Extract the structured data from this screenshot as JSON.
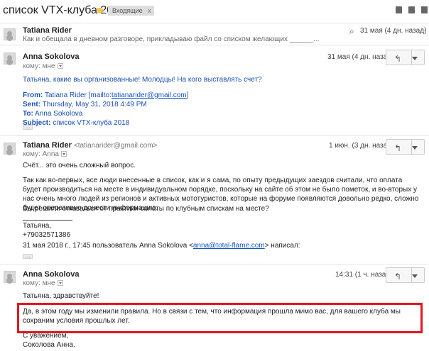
{
  "thread": {
    "subject": "список VTX-клуба 2018",
    "inbox_label": "Входящие",
    "inbox_close": "x"
  },
  "messages": [
    {
      "sender": "Tatiana Rider",
      "snippet": "Как и обещала в дневном разговоре, прикладываю файл со списком желающих ______...",
      "date": "31 мая (4 дн. назад)"
    },
    {
      "sender": "Anna Sokolova",
      "to": "кому: мне",
      "date": "31 мая (4 дн. назад)",
      "text": "Татьяна, какие вы организованные! Молодцы! На кого выставлять счет?",
      "quote": {
        "from_label": "From:",
        "from_value": "Tatiana Rider [mailto:",
        "from_link": "tatianarider@gmail.com",
        "from_end": "]",
        "sent_label": "Sent:",
        "sent_value": "Thursday, May 31, 2018 4:49 PM",
        "to_label": "To:",
        "to_value": "Anna Sokolova",
        "subject_label": "Subject:",
        "subject_value": "список VTX-клуба 2018"
      }
    },
    {
      "sender": "Tatiana Rider",
      "email": "<tatianarider@gmail.com>",
      "to": "кому: Anna",
      "date": "1 июн. (3 дн. назад)",
      "p1": "Счёт... это очень сложный вопрос.",
      "p2": "Так как во-первых, все люди внесенные в список, как и я сама, по опыту предыдущих заездов считали, что оплата будет производиться на месте в индивидуальном порядке, поскольку на сайте об этом не было пометок, и во-вторых у нас очень много людей из регионов и активных мототуристов, которые на форуме появляются довольно редко, сложно будет оперативно донести информацию.",
      "p3": "Вы решили отказаться от практики оплаты по клубным спискам на месте?",
      "sig_name": "Татьяна,",
      "sig_phone": "+79032571386",
      "quote_intro": "31 мая 2018 г., 17:45 пользователь Anna Sokolova <",
      "quote_link": "anna@total-flame.com",
      "quote_end": "> написал:"
    },
    {
      "sender": "Anna Sokolova",
      "to": "кому: мне",
      "date": "14:31 (1 ч. назад)",
      "greeting": "Татьяна, здравствуйте!",
      "p1": "Да, в этом году мы изменили правила. Но в связи с тем, что информация прошла мимо вас, для вашего клуба мы сохраним условия прошлых лет.",
      "regards": "С уважением,",
      "name": "Соколова Анна."
    }
  ],
  "ellipsis": "...",
  "icons": {
    "star": "☆",
    "reply": "↰",
    "attachment": "paperclip-icon"
  }
}
